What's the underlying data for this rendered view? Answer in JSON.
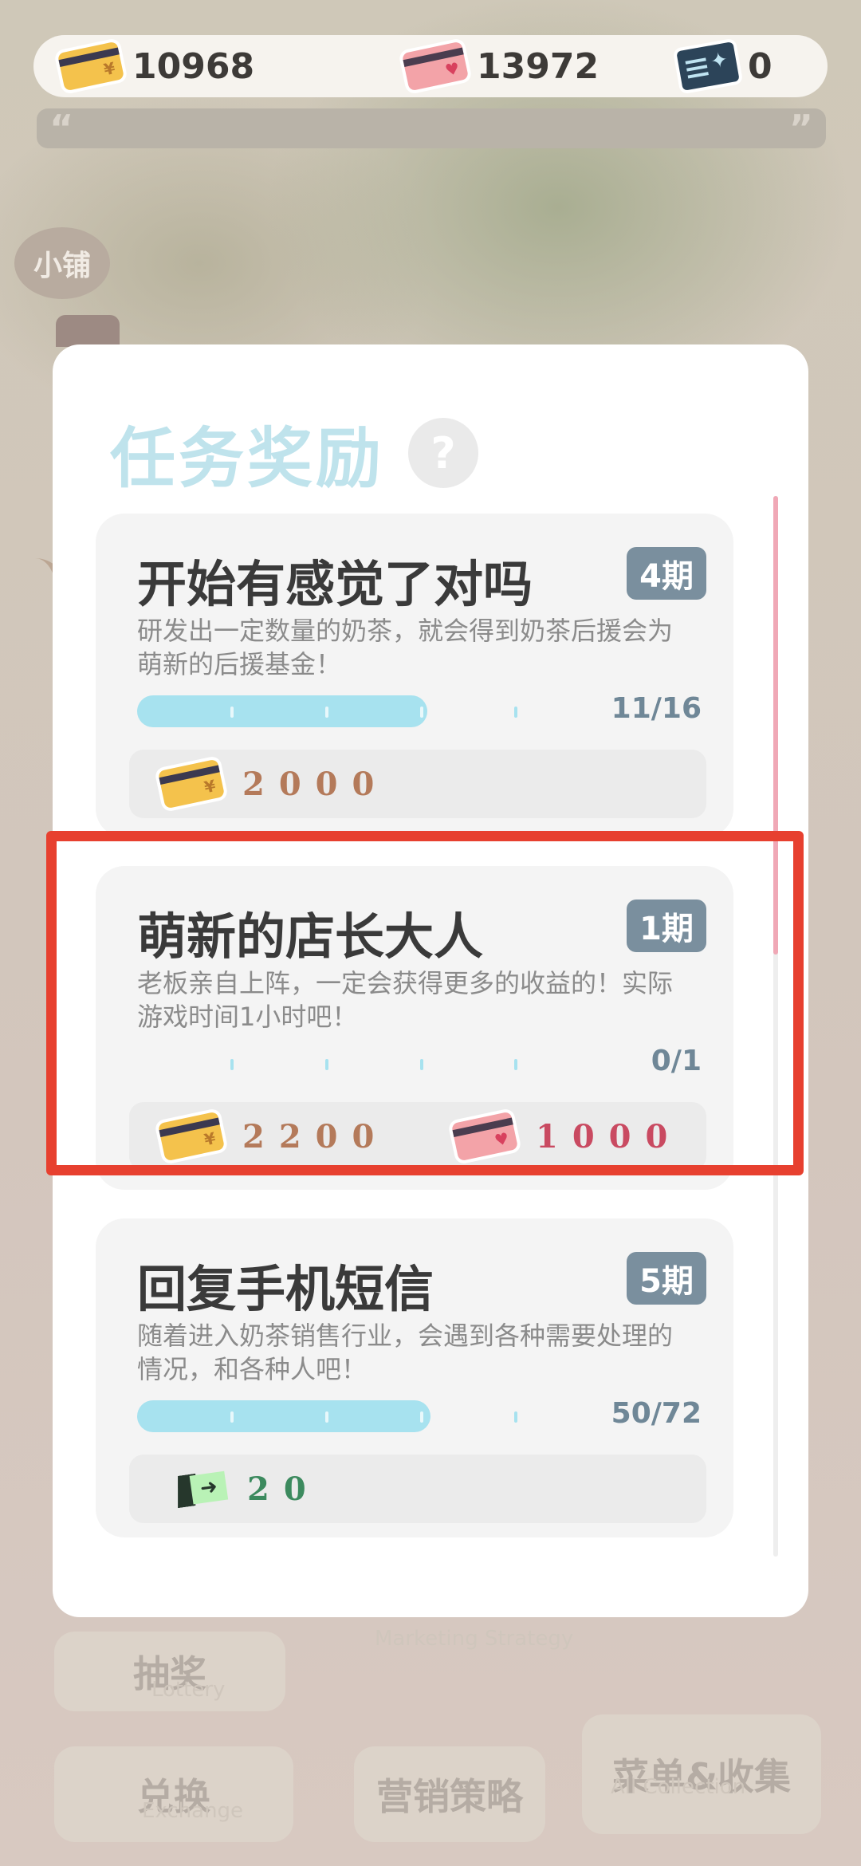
{
  "currencies": [
    {
      "name": "gold-card",
      "value": "10968"
    },
    {
      "name": "pink-card",
      "value": "13972"
    },
    {
      "name": "ticket",
      "value": "0"
    }
  ],
  "quote": {
    "open": "“",
    "close": "”"
  },
  "background": {
    "shop_label": "小铺",
    "menu": {
      "lottery": "抽奖",
      "lottery_sub": "Lottery",
      "exchange": "兑换",
      "exchange_sub": "Exchange",
      "marketing": "营销策略",
      "marketing_sub": "Marketing Strategy",
      "menu_collection": "菜单&收集",
      "menu_collection_sub": "All Collection"
    }
  },
  "panel": {
    "title": "任务奖励",
    "help": "?",
    "tasks": [
      {
        "title": "开始有感觉了对吗",
        "period": "4期",
        "description": "研发出一定数量的奶茶，就会得到奶茶后援会为萌新的后援基金！",
        "progress_text": "11/16",
        "progress": 0.6875,
        "rewards": [
          {
            "icon": "gold-card-icon",
            "amount": "2000"
          }
        ]
      },
      {
        "title": "萌新的店长大人",
        "period": "1期",
        "description": "老板亲自上阵，一定会获得更多的收益的！实际游戏时间1小时吧！",
        "progress_text": "0/1",
        "progress": 0,
        "rewards": [
          {
            "icon": "gold-card-icon",
            "amount": "2200"
          },
          {
            "icon": "pink-card-icon",
            "amount": "1000"
          }
        ]
      },
      {
        "title": "回复手机短信",
        "period": "5期",
        "description": "随着进入奶茶销售行业，会遇到各种需要处理的情况，和各种人吧！",
        "progress_text": "50/72",
        "progress": 0.6944,
        "rewards": [
          {
            "icon": "ticket-icon",
            "amount": "20"
          }
        ]
      }
    ]
  },
  "colors": {
    "title": "#bfe3ec",
    "progress_fill": "#a7e2ef",
    "period_badge": "#7a8f9e",
    "highlight": "#e7402f"
  }
}
